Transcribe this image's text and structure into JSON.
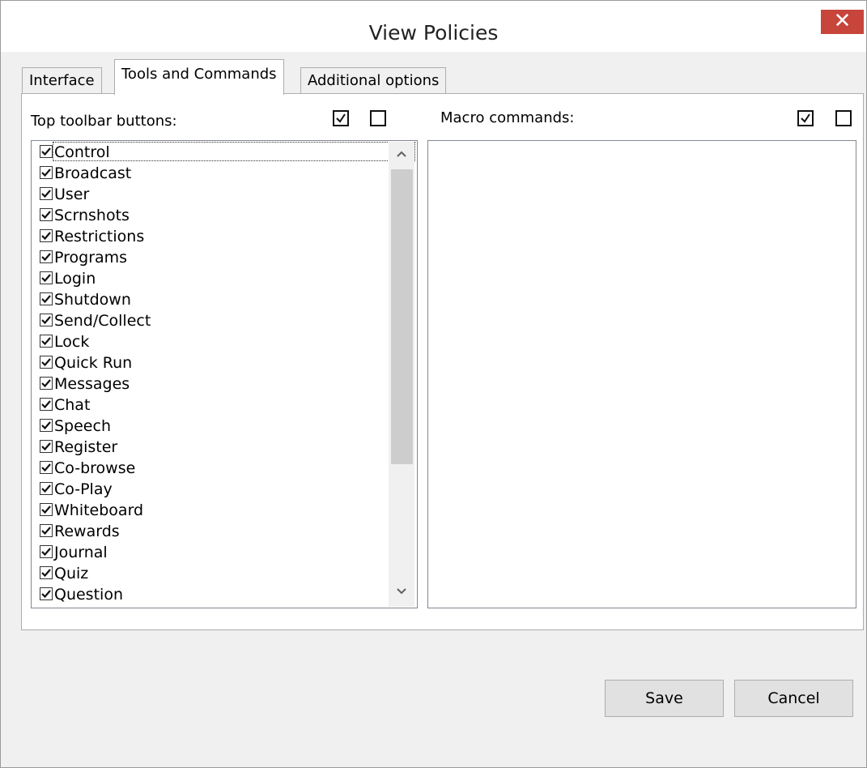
{
  "window": {
    "title": "View Policies",
    "close_glyph": "✕"
  },
  "tabs": [
    {
      "label": "Interface",
      "active": false
    },
    {
      "label": "Tools and Commands",
      "active": true
    },
    {
      "label": "Additional options",
      "active": false
    }
  ],
  "toolbar_section": {
    "label": "Top toolbar buttons:",
    "check_all_icon": "checked-box-icon",
    "uncheck_all_icon": "empty-box-icon",
    "items": [
      {
        "label": "Control",
        "checked": true
      },
      {
        "label": "Broadcast",
        "checked": true
      },
      {
        "label": "User",
        "checked": true
      },
      {
        "label": "Scrnshots",
        "checked": true
      },
      {
        "label": "Restrictions",
        "checked": true
      },
      {
        "label": "Programs",
        "checked": true
      },
      {
        "label": "Login",
        "checked": true
      },
      {
        "label": "Shutdown",
        "checked": true
      },
      {
        "label": "Send/Collect",
        "checked": true
      },
      {
        "label": "Lock",
        "checked": true
      },
      {
        "label": "Quick Run",
        "checked": true
      },
      {
        "label": "Messages",
        "checked": true
      },
      {
        "label": "Chat",
        "checked": true
      },
      {
        "label": "Speech",
        "checked": true
      },
      {
        "label": "Register",
        "checked": true
      },
      {
        "label": "Co-browse",
        "checked": true
      },
      {
        "label": "Co-Play",
        "checked": true
      },
      {
        "label": "Whiteboard",
        "checked": true
      },
      {
        "label": "Rewards",
        "checked": true
      },
      {
        "label": "Journal",
        "checked": true
      },
      {
        "label": "Quiz",
        "checked": true
      },
      {
        "label": "Question",
        "checked": true
      }
    ]
  },
  "macro_section": {
    "label": "Macro commands:",
    "check_all_icon": "checked-box-icon",
    "uncheck_all_icon": "empty-box-icon",
    "items": []
  },
  "buttons": {
    "save": "Save",
    "cancel": "Cancel"
  },
  "colors": {
    "close_button": "#c7453b",
    "dialog_background": "#f0f0f0"
  }
}
